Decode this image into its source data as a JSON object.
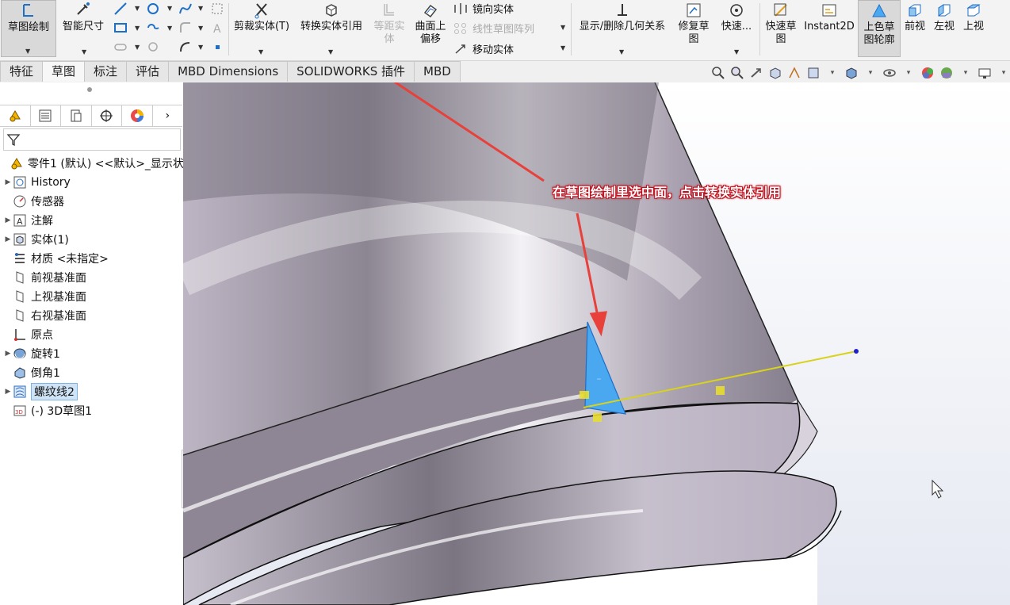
{
  "ribbon": {
    "sketch": "草图绘制",
    "smart_dim": "智能尺寸",
    "trim": "剪裁实体(T)",
    "convert": "转换实体引用",
    "offset": "等距实\n体",
    "surface_offset": "曲面上\n偏移",
    "mirror": "镜向实体",
    "linear_pattern": "线性草图阵列",
    "move": "移动实体",
    "relations": "显示/删除几何关系",
    "repair": "修复草\n图",
    "quick_snaps": "快速...",
    "rapid_sketch": "快速草\n图",
    "instant2d": "Instant2D",
    "shaded_sketch": "上色草\n图轮廓",
    "front": "前视",
    "left": "左视",
    "top": "上视"
  },
  "tabs": [
    "特征",
    "草图",
    "标注",
    "评估",
    "MBD Dimensions",
    "SOLIDWORKS 插件",
    "MBD"
  ],
  "active_tab": "草图",
  "tree": {
    "root": "零件1 (默认) <<默认>_显示状",
    "items": [
      {
        "label": "History",
        "icon": "history-icon",
        "expand": true
      },
      {
        "label": "传感器",
        "icon": "sensor-icon",
        "expand": false
      },
      {
        "label": "注解",
        "icon": "annotation-icon",
        "expand": true
      },
      {
        "label": "实体(1)",
        "icon": "solid-bodies-icon",
        "expand": true
      },
      {
        "label": "材质 <未指定>",
        "icon": "material-icon",
        "expand": false
      },
      {
        "label": "前视基准面",
        "icon": "plane-icon",
        "expand": false
      },
      {
        "label": "上视基准面",
        "icon": "plane-icon",
        "expand": false
      },
      {
        "label": "右视基准面",
        "icon": "plane-icon",
        "expand": false
      },
      {
        "label": "原点",
        "icon": "origin-icon",
        "expand": false
      },
      {
        "label": "旋转1",
        "icon": "revolve-icon",
        "expand": true
      },
      {
        "label": "倒角1",
        "icon": "chamfer-icon",
        "expand": false
      },
      {
        "label": "螺纹线2",
        "icon": "helix-icon",
        "expand": true,
        "selected": true
      },
      {
        "label": "(-) 3D草图1",
        "icon": "3d-sketch-icon",
        "expand": false
      }
    ]
  },
  "annotation": "在草图绘制里选中面，点击转换实体引用",
  "colors": {
    "accent": "#4aa8f0",
    "arrow": "#e8403a",
    "sketch_line": "#d8d21a",
    "face": "#b2aab8"
  }
}
